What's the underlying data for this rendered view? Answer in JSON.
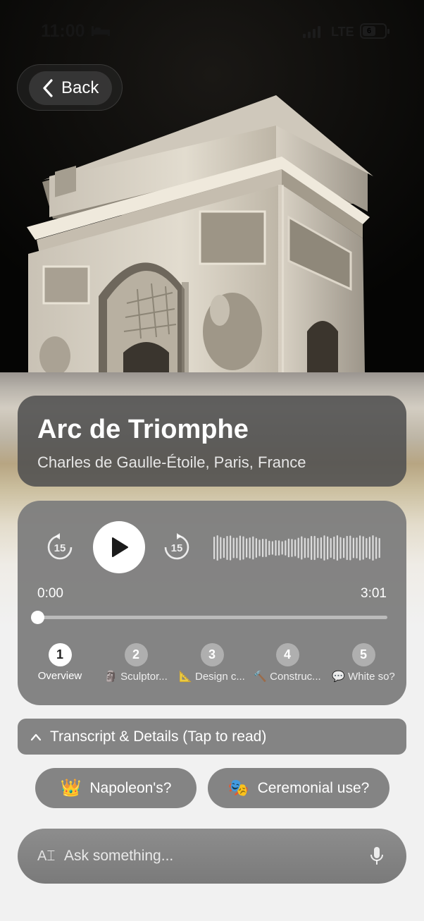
{
  "status_bar": {
    "time": "11:00",
    "network": "LTE",
    "battery": "6"
  },
  "nav": {
    "back_label": "Back"
  },
  "place": {
    "title": "Arc de Triomphe",
    "subtitle": "Charles de Gaulle-Étoile, Paris, France"
  },
  "player": {
    "skip_back_seconds": "15",
    "skip_forward_seconds": "15",
    "current_time": "0:00",
    "total_time": "3:01",
    "progress": 0,
    "chapters": [
      {
        "number": "1",
        "label": "Overview",
        "active": true
      },
      {
        "number": "2",
        "label": "🗿 Sculptor...",
        "active": false
      },
      {
        "number": "3",
        "label": "📐 Design c...",
        "active": false
      },
      {
        "number": "4",
        "label": "🔨 Construc...",
        "active": false
      },
      {
        "number": "5",
        "label": "💬 White so?",
        "active": false
      }
    ]
  },
  "transcript": {
    "label": "Transcript & Details (Tap to read)"
  },
  "suggestions": [
    {
      "emoji": "👑",
      "text": "Napoleon's?"
    },
    {
      "emoji": "🎭",
      "text": "Ceremonial use?"
    }
  ],
  "ask": {
    "placeholder": "Ask something..."
  },
  "icons": {
    "back": "chevron-left-icon",
    "play": "play-icon",
    "skip_back": "rewind-15-icon",
    "skip_forward": "forward-15-icon",
    "transcript_toggle": "chevron-up-icon",
    "ask_prefix": "text-cursor-icon",
    "mic": "microphone-icon"
  },
  "colors": {
    "card": "#7d7d7d",
    "title_card": "#505050",
    "hero_sky": "#0b0a08",
    "stone": "#d8d2c6"
  }
}
